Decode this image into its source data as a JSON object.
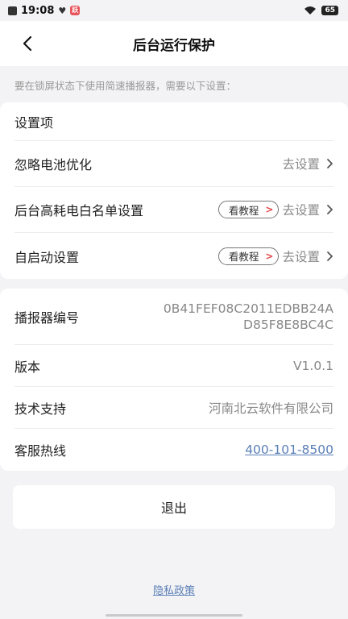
{
  "status_bar": {
    "time": "19:08",
    "app_badge": "跃",
    "battery": "65"
  },
  "nav": {
    "title": "后台运行保护"
  },
  "hint": "要在锁屏状态下使用简速播报器，需要以下设置：",
  "settings": {
    "header": "设置项",
    "items": [
      {
        "label": "忽略电池优化",
        "action": "去设置"
      },
      {
        "label": "后台高耗电白名单设置",
        "tutorial": "看教程",
        "action": "去设置"
      },
      {
        "label": "自启动设置",
        "tutorial": "看教程",
        "action": "去设置"
      }
    ]
  },
  "info": {
    "device_id": {
      "label": "播报器编号",
      "line1": "0B41FEF08C2011EDBB24A",
      "line2": "D85F8E8BC4C"
    },
    "version": {
      "label": "版本",
      "value": "V1.0.1"
    },
    "support": {
      "label": "技术支持",
      "value": "河南北云软件有限公司"
    },
    "hotline": {
      "label": "客服热线",
      "value": "400-101-8500"
    }
  },
  "logout_label": "退出",
  "privacy_label": "隐私政策",
  "colors": {
    "link": "#5b7fb6",
    "tutorial_arrow": "#e34a4a",
    "background": "#f3f3f5"
  }
}
